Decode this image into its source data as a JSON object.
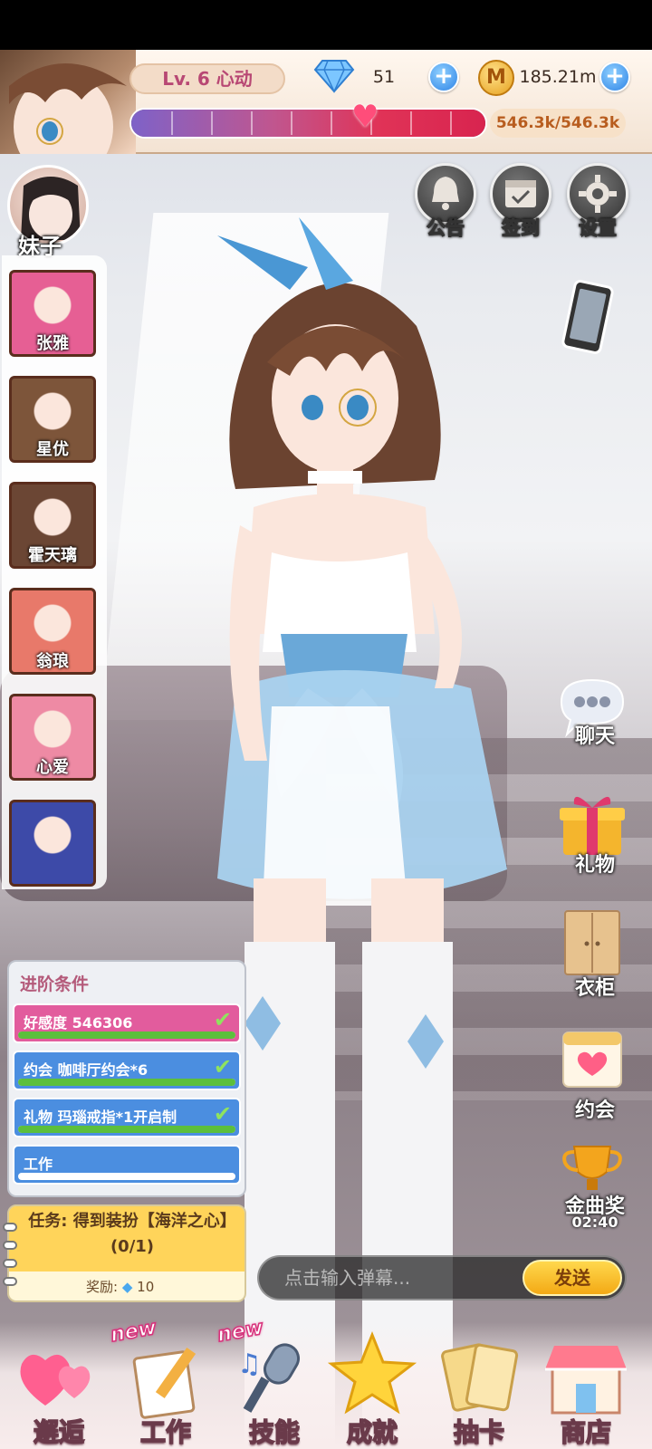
{
  "hud": {
    "level": "Lv. 6 心动",
    "diamonds": "51",
    "coins": "185.21m",
    "affection_progress": "546.3k/546.3k",
    "affection_fraction": 1.0
  },
  "top_buttons": [
    {
      "label": "公告",
      "icon": "bell-icon"
    },
    {
      "label": "签到",
      "icon": "calendar-check-icon"
    },
    {
      "label": "设置",
      "icon": "gear-icon"
    }
  ],
  "roster": {
    "current_label": "妹子",
    "items": [
      {
        "name": "张雅",
        "color": "#e65f94"
      },
      {
        "name": "星优",
        "color": "#7d553a"
      },
      {
        "name": "霍天璃",
        "color": "#6b4634"
      },
      {
        "name": "翁琅",
        "color": "#e8796a"
      },
      {
        "name": "心爱",
        "color": "#ee8aa4"
      },
      {
        "name": "",
        "color": "#3d4aa8"
      }
    ]
  },
  "side_menu": [
    {
      "label": "聊天",
      "icon": "chat-bubble-icon"
    },
    {
      "label": "礼物",
      "icon": "gift-icon"
    },
    {
      "label": "衣柜",
      "icon": "wardrobe-icon"
    },
    {
      "label": "约会",
      "icon": "date-calendar-icon"
    },
    {
      "label": "金曲奖",
      "icon": "trophy-icon",
      "timer": "02:40"
    }
  ],
  "requirements": {
    "title": "进阶条件",
    "rows": [
      {
        "text": "好感度 546306",
        "done": true,
        "color": "#e25c9d",
        "progress": 1.0
      },
      {
        "text": "约会 咖啡厅约会*6",
        "done": true,
        "color": "#4b8ee0",
        "progress": 1.0
      },
      {
        "text": "礼物 玛瑙戒指*1开启制",
        "done": true,
        "color": "#4b8ee0",
        "progress": 1.0
      },
      {
        "text": "工作",
        "done": false,
        "color": "#4b8ee0",
        "progress": 0.0
      }
    ]
  },
  "task": {
    "text": "任务: 得到装扮【海洋之心】(0/1)",
    "reward_label": "奖励:",
    "reward_value": "10"
  },
  "danmaku": {
    "placeholder": "点击输入弹幕...",
    "send_label": "发送"
  },
  "bottom_nav": [
    {
      "label": "邂逅",
      "icon": "hearts-icon",
      "new": false
    },
    {
      "label": "工作",
      "icon": "notepad-pencil-icon",
      "new": true
    },
    {
      "label": "技能",
      "icon": "microphone-music-icon",
      "new": true
    },
    {
      "label": "成就",
      "icon": "star-icon",
      "new": false
    },
    {
      "label": "抽卡",
      "icon": "cards-icon",
      "new": false
    },
    {
      "label": "商店",
      "icon": "shop-icon",
      "new": false
    }
  ],
  "new_tag": "new"
}
